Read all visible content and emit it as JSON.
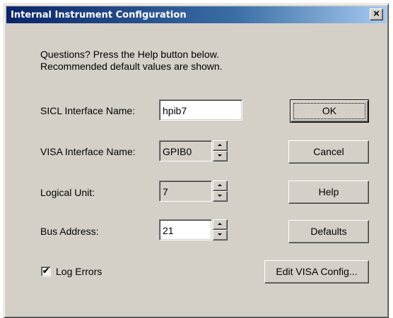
{
  "window": {
    "title": "Internal Instrument Configuration",
    "close_glyph": "×"
  },
  "info": {
    "line1": "Questions?  Press the Help button below.",
    "line2": "Recommended default values are shown."
  },
  "fields": {
    "sicl": {
      "label": "SICL Interface Name:",
      "value": "hpib7"
    },
    "visa": {
      "label": "VISA Interface Name:",
      "value": "GPIB0"
    },
    "logical_unit": {
      "label": "Logical Unit:",
      "value": "7"
    },
    "bus_address": {
      "label": "Bus Address:",
      "value": "21"
    }
  },
  "checkbox": {
    "label": "Log Errors",
    "checked": true,
    "check_glyph": "✔"
  },
  "buttons": {
    "ok": "OK",
    "cancel": "Cancel",
    "help": "Help",
    "defaults": "Defaults",
    "edit_visa": "Edit VISA Config..."
  },
  "icons": {
    "close": "close-icon",
    "spin_up": "spin-up-arrow-icon",
    "spin_down": "spin-down-arrow-icon",
    "check": "checkmark-icon"
  }
}
